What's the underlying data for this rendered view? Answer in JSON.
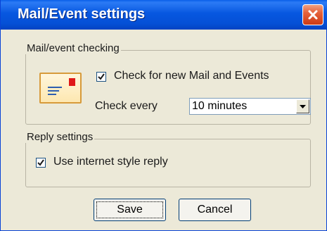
{
  "window": {
    "title": "Mail/Event settings",
    "close_icon": "close-icon",
    "title_color": "#0757e0",
    "close_color": "#e5613a"
  },
  "mail_group": {
    "label": "Mail/event checking",
    "icon": "mail-envelope-icon",
    "check_label": "Check for new Mail and Events",
    "check_checked": true,
    "interval_label": "Check every",
    "interval_value": "10 minutes"
  },
  "reply_group": {
    "label": "Reply settings",
    "check_label": "Use internet style reply",
    "check_checked": true
  },
  "buttons": {
    "save": "Save",
    "cancel": "Cancel"
  }
}
